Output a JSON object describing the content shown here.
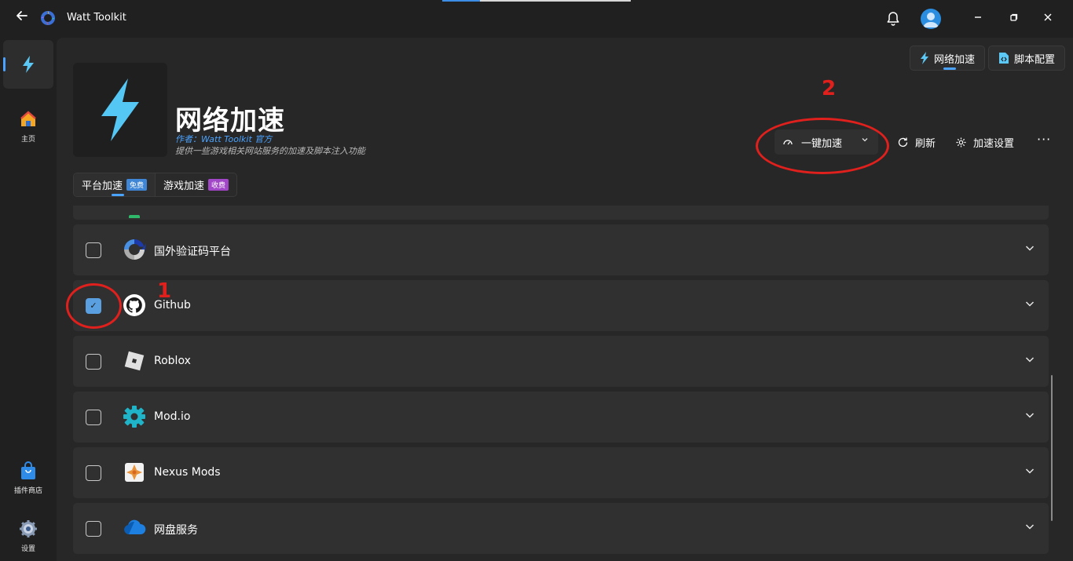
{
  "window": {
    "app_title": "Watt Toolkit"
  },
  "sidebar": {
    "items": [
      {
        "label": "",
        "icon": "lightning-icon"
      },
      {
        "label": "主页",
        "icon": "home-icon"
      },
      {
        "label": "插件商店",
        "icon": "shop-bag-icon"
      },
      {
        "label": "设置",
        "icon": "gear-icon"
      }
    ]
  },
  "header_tabs": [
    {
      "label": "网络加速",
      "active": true
    },
    {
      "label": "脚本配置",
      "active": false
    }
  ],
  "hero": {
    "title": "网络加速",
    "author": "作者：Watt Toolkit 官方",
    "description": "提供一些游戏相关网站服务的加速及脚本注入功能"
  },
  "actions": {
    "accelerate": "一键加速",
    "refresh": "刷新",
    "settings": "加速设置",
    "more": "···"
  },
  "sub_tabs": [
    {
      "label": "平台加速",
      "badge": "免费",
      "badge_color": "#3f86d6",
      "active": true
    },
    {
      "label": "游戏加速",
      "badge": "收费",
      "badge_color": "#a246c8",
      "active": false
    }
  ],
  "services": [
    {
      "name": "国外验证码平台",
      "checked": false,
      "icon": "recaptcha-icon"
    },
    {
      "name": "Github",
      "checked": true,
      "icon": "github-icon"
    },
    {
      "name": "Roblox",
      "checked": false,
      "icon": "roblox-icon"
    },
    {
      "name": "Mod.io",
      "checked": false,
      "icon": "modio-icon"
    },
    {
      "name": "Nexus Mods",
      "checked": false,
      "icon": "nexus-mods-icon"
    },
    {
      "name": "网盘服务",
      "checked": false,
      "icon": "cloud-drive-icon"
    }
  ],
  "annotations": {
    "one": "1",
    "two": "2",
    "color": "#e0201c"
  },
  "colors": {
    "accent": "#4aa3ff",
    "background": "#202020",
    "panel": "#272727",
    "card": "#303030"
  }
}
